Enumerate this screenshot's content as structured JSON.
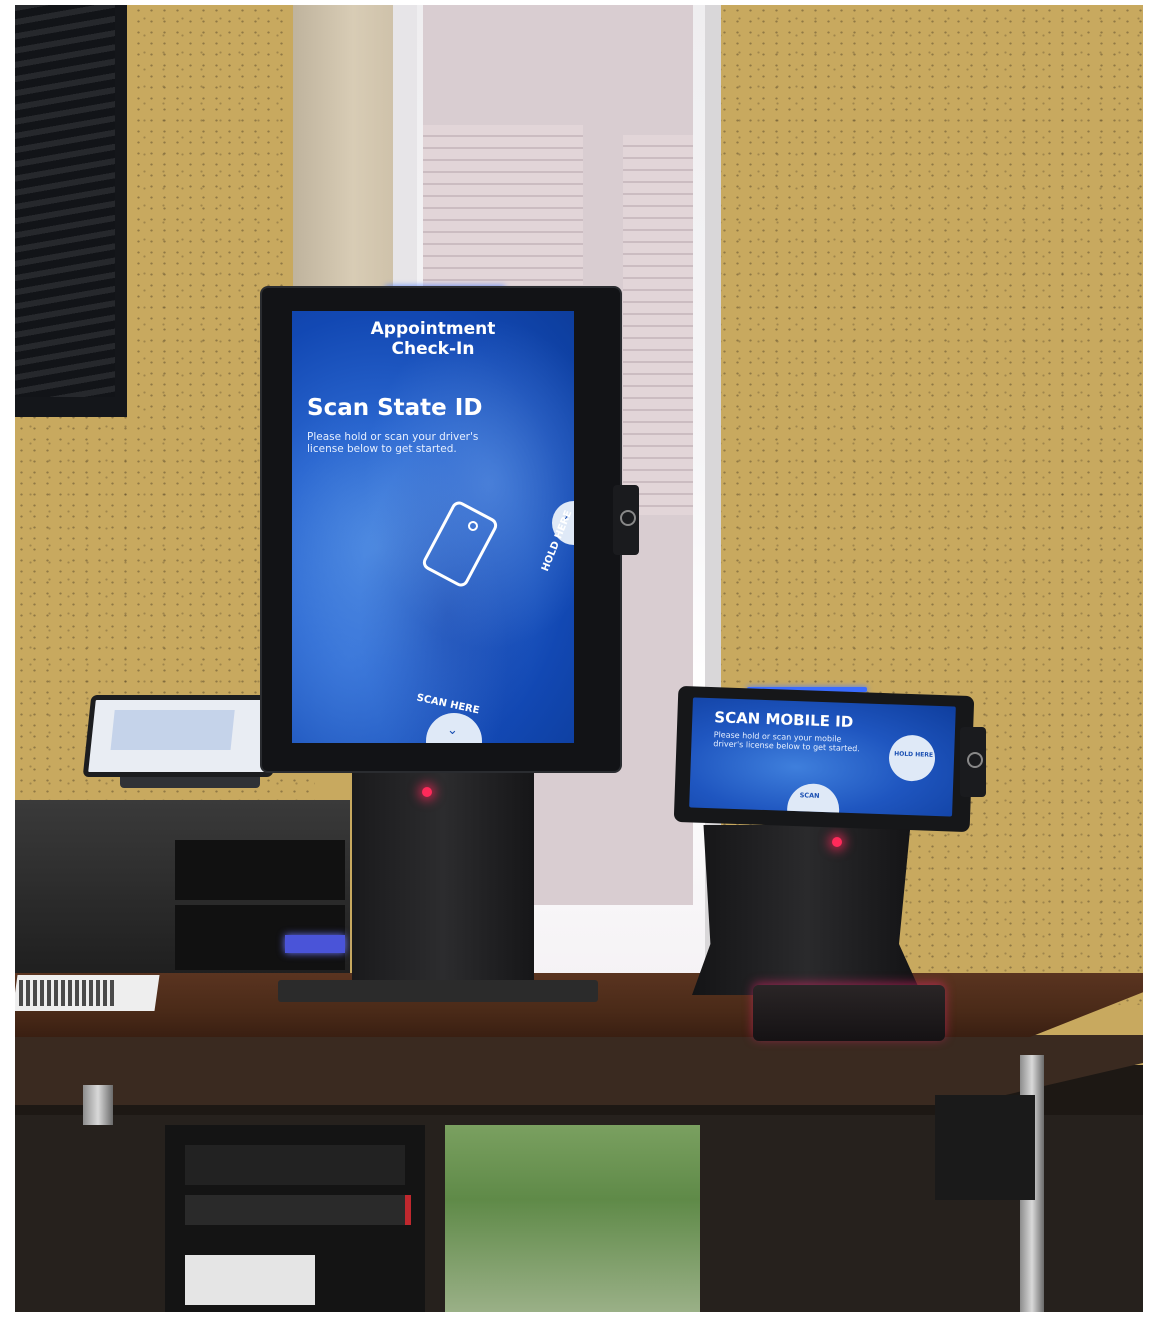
{
  "scene": {
    "description_colors": {
      "screen_blue": "#1248b3",
      "wall_gold": "#c4a55c",
      "led_red": "#ff2a5a"
    }
  },
  "main_kiosk": {
    "title": "Appointment\nCheck-In",
    "heading": "Scan State ID",
    "subtext": "Please hold or scan your driver's license below to get started.",
    "hold_label": "HOLD HERE",
    "scan_label": "SCAN HERE",
    "hold_arrow": "›",
    "scan_arrow": "⌄"
  },
  "small_kiosk": {
    "heading": "SCAN MOBILE ID",
    "subtext": "Please hold or scan your mobile driver's license below to get started.",
    "hold_label": "HOLD HERE ›",
    "scan_label": "SCAN"
  }
}
